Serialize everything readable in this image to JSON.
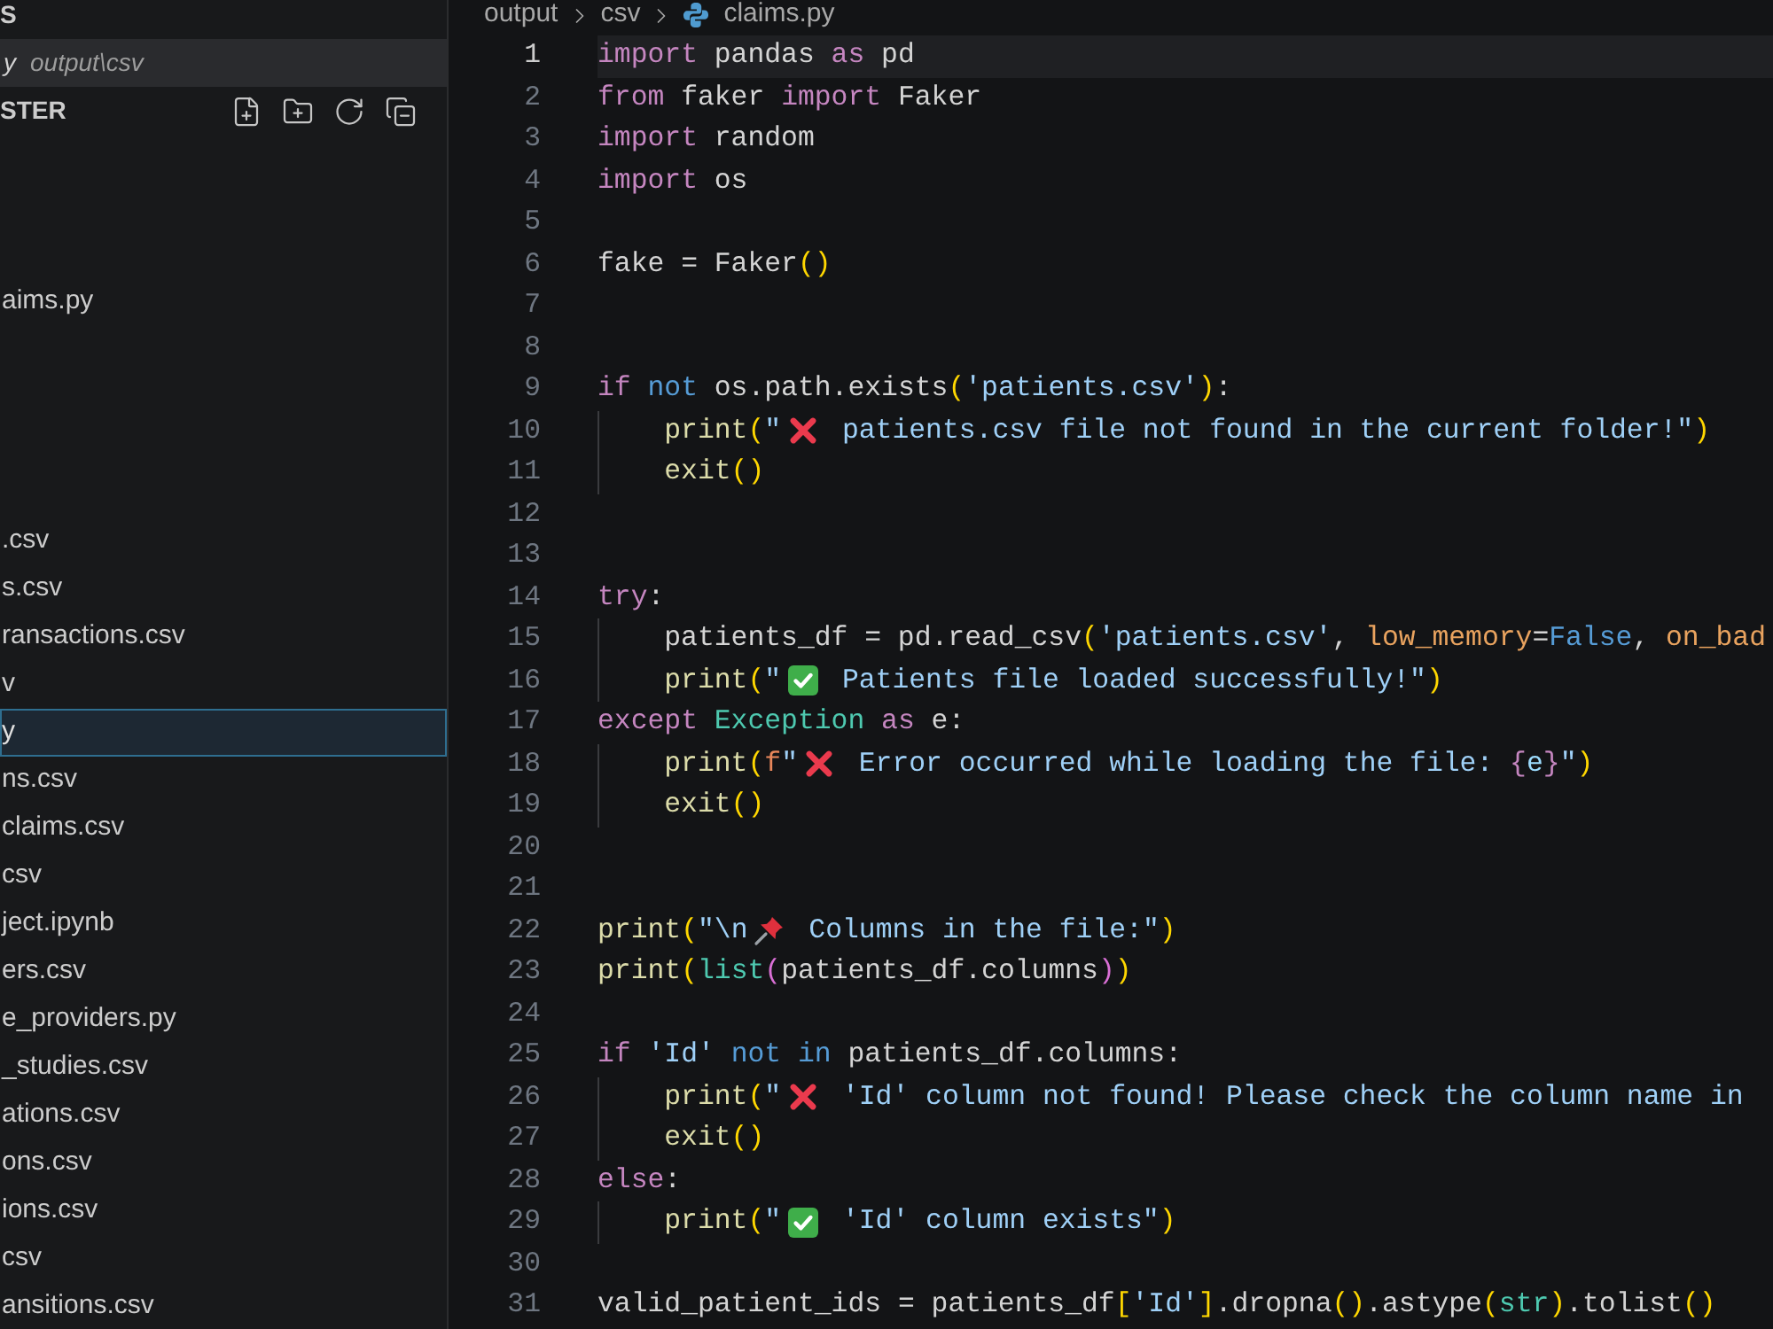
{
  "sidebar": {
    "section_title": "S",
    "open_editor": {
      "name": "y",
      "path": "output\\csv",
      "selected": true
    },
    "explorer": {
      "title": "STER",
      "top_items": [
        {
          "name": "aims.py",
          "selected": false
        }
      ],
      "items": [
        {
          "name": ".csv",
          "selected": false
        },
        {
          "name": "s.csv",
          "selected": false
        },
        {
          "name": "ransactions.csv",
          "selected": false
        },
        {
          "name": "v",
          "selected": false
        },
        {
          "name": "y",
          "selected": true
        },
        {
          "name": "ns.csv",
          "selected": false
        },
        {
          "name": "claims.csv",
          "selected": false
        },
        {
          "name": "csv",
          "selected": false
        },
        {
          "name": "ject.ipynb",
          "selected": false
        },
        {
          "name": "ers.csv",
          "selected": false
        },
        {
          "name": "e_providers.py",
          "selected": false
        },
        {
          "name": "_studies.csv",
          "selected": false
        },
        {
          "name": "ations.csv",
          "selected": false
        },
        {
          "name": "ons.csv",
          "selected": false
        },
        {
          "name": "ions.csv",
          "selected": false
        },
        {
          "name": "csv",
          "selected": false
        },
        {
          "name": "ansitions.csv",
          "selected": false
        }
      ]
    }
  },
  "editor": {
    "breadcrumb": [
      {
        "kind": "folder",
        "text": "output"
      },
      {
        "kind": "folder",
        "text": "csv"
      },
      {
        "kind": "python",
        "text": "claims.py"
      }
    ],
    "lines": [
      {
        "number": "1",
        "current": true,
        "tokens": [
          {
            "kind": "keyword",
            "text": "import"
          },
          {
            "kind": "plain",
            "text": " pandas "
          },
          {
            "kind": "keyword",
            "text": "as"
          },
          {
            "kind": "plain",
            "text": " pd"
          }
        ]
      },
      {
        "number": "2",
        "current": false,
        "tokens": [
          {
            "kind": "keyword",
            "text": "from"
          },
          {
            "kind": "plain",
            "text": " faker "
          },
          {
            "kind": "keyword",
            "text": "import"
          },
          {
            "kind": "plain",
            "text": " Faker"
          }
        ]
      },
      {
        "number": "3",
        "current": false,
        "tokens": [
          {
            "kind": "keyword",
            "text": "import"
          },
          {
            "kind": "plain",
            "text": " random"
          }
        ]
      },
      {
        "number": "4",
        "current": false,
        "tokens": [
          {
            "kind": "keyword",
            "text": "import"
          },
          {
            "kind": "plain",
            "text": " os"
          }
        ]
      },
      {
        "number": "5",
        "current": false
      },
      {
        "number": "6",
        "current": false,
        "tokens": [
          {
            "kind": "plain",
            "text": "fake = Faker"
          },
          {
            "kind": "paren1",
            "text": "()"
          }
        ]
      },
      {
        "number": "7",
        "current": false
      },
      {
        "number": "8",
        "current": false
      },
      {
        "number": "9",
        "current": false,
        "tokens": [
          {
            "kind": "keyword",
            "text": "if"
          },
          {
            "kind": "logic",
            "text": " not"
          },
          {
            "kind": "plain",
            "text": " os.path.exists"
          },
          {
            "kind": "paren1",
            "text": "("
          },
          {
            "kind": "string",
            "text": "'patients.csv'"
          },
          {
            "kind": "paren1",
            "text": ")"
          },
          {
            "kind": "plain",
            "text": ":"
          }
        ]
      },
      {
        "number": "10",
        "current": false,
        "tokens": [
          {
            "kind": "indent"
          },
          {
            "kind": "function",
            "text": "print"
          },
          {
            "kind": "paren1",
            "text": "("
          },
          {
            "kind": "string",
            "text": "\""
          },
          {
            "kind": "cross"
          },
          {
            "kind": "string",
            "text": " patients.csv file not found in the current folder!\""
          },
          {
            "kind": "paren1",
            "text": ")"
          }
        ]
      },
      {
        "number": "11",
        "current": false,
        "tokens": [
          {
            "kind": "indent"
          },
          {
            "kind": "function",
            "text": "exit"
          },
          {
            "kind": "paren1",
            "text": "()"
          }
        ]
      },
      {
        "number": "12",
        "current": false
      },
      {
        "number": "13",
        "current": false
      },
      {
        "number": "14",
        "current": false,
        "tokens": [
          {
            "kind": "keyword",
            "text": "try"
          },
          {
            "kind": "plain",
            "text": ":"
          }
        ]
      },
      {
        "number": "15",
        "current": false,
        "tokens": [
          {
            "kind": "indent"
          },
          {
            "kind": "plain",
            "text": "patients_df = pd.read_csv"
          },
          {
            "kind": "paren1",
            "text": "("
          },
          {
            "kind": "string",
            "text": "'patients.csv'"
          },
          {
            "kind": "plain",
            "text": ", "
          },
          {
            "kind": "param",
            "text": "low_memory"
          },
          {
            "kind": "plain",
            "text": "="
          },
          {
            "kind": "constant",
            "text": "False"
          },
          {
            "kind": "plain",
            "text": ", "
          },
          {
            "kind": "param",
            "text": "on_bad"
          }
        ]
      },
      {
        "number": "16",
        "current": false,
        "tokens": [
          {
            "kind": "indent"
          },
          {
            "kind": "function",
            "text": "print"
          },
          {
            "kind": "paren1",
            "text": "("
          },
          {
            "kind": "string",
            "text": "\""
          },
          {
            "kind": "check"
          },
          {
            "kind": "string",
            "text": " Patients file loaded successfully!\""
          },
          {
            "kind": "paren1",
            "text": ")"
          }
        ]
      },
      {
        "number": "17",
        "current": false,
        "tokens": [
          {
            "kind": "keyword",
            "text": "except"
          },
          {
            "kind": "class",
            "text": " Exception"
          },
          {
            "kind": "keyword",
            "text": " as"
          },
          {
            "kind": "plain",
            "text": " e:"
          }
        ]
      },
      {
        "number": "18",
        "current": false,
        "tokens": [
          {
            "kind": "indent"
          },
          {
            "kind": "function",
            "text": "print"
          },
          {
            "kind": "paren1",
            "text": "("
          },
          {
            "kind": "prefix",
            "text": "f"
          },
          {
            "kind": "string",
            "text": "\""
          },
          {
            "kind": "cross"
          },
          {
            "kind": "string",
            "text": " Error occurred while loading the file: "
          },
          {
            "kind": "brace",
            "text": "{"
          },
          {
            "kind": "variable",
            "text": "e"
          },
          {
            "kind": "brace",
            "text": "}"
          },
          {
            "kind": "string",
            "text": "\""
          },
          {
            "kind": "paren1",
            "text": ")"
          }
        ]
      },
      {
        "number": "19",
        "current": false,
        "tokens": [
          {
            "kind": "indent"
          },
          {
            "kind": "function",
            "text": "exit"
          },
          {
            "kind": "paren1",
            "text": "()"
          }
        ]
      },
      {
        "number": "20",
        "current": false
      },
      {
        "number": "21",
        "current": false
      },
      {
        "number": "22",
        "current": false,
        "tokens": [
          {
            "kind": "function",
            "text": "print"
          },
          {
            "kind": "paren1",
            "text": "("
          },
          {
            "kind": "string",
            "text": "\"\\n"
          },
          {
            "kind": "pin"
          },
          {
            "kind": "string",
            "text": " Columns in the file:\""
          },
          {
            "kind": "paren1",
            "text": ")"
          }
        ]
      },
      {
        "number": "23",
        "current": false,
        "tokens": [
          {
            "kind": "function",
            "text": "print"
          },
          {
            "kind": "paren1",
            "text": "("
          },
          {
            "kind": "class",
            "text": "list"
          },
          {
            "kind": "paren2",
            "text": "("
          },
          {
            "kind": "plain",
            "text": "patients_df.columns"
          },
          {
            "kind": "paren2",
            "text": ")"
          },
          {
            "kind": "paren1",
            "text": ")"
          }
        ]
      },
      {
        "number": "24",
        "current": false
      },
      {
        "number": "25",
        "current": false,
        "tokens": [
          {
            "kind": "keyword",
            "text": "if"
          },
          {
            "kind": "string",
            "text": " 'Id'"
          },
          {
            "kind": "logic",
            "text": " not in"
          },
          {
            "kind": "plain",
            "text": " patients_df.columns:"
          }
        ]
      },
      {
        "number": "26",
        "current": false,
        "tokens": [
          {
            "kind": "indent"
          },
          {
            "kind": "function",
            "text": "print"
          },
          {
            "kind": "paren1",
            "text": "("
          },
          {
            "kind": "string",
            "text": "\""
          },
          {
            "kind": "cross"
          },
          {
            "kind": "string",
            "text": " 'Id' column not found! Please check the column name in"
          }
        ]
      },
      {
        "number": "27",
        "current": false,
        "tokens": [
          {
            "kind": "indent"
          },
          {
            "kind": "function",
            "text": "exit"
          },
          {
            "kind": "paren1",
            "text": "()"
          }
        ]
      },
      {
        "number": "28",
        "current": false,
        "tokens": [
          {
            "kind": "keyword",
            "text": "else"
          },
          {
            "kind": "plain",
            "text": ":"
          }
        ]
      },
      {
        "number": "29",
        "current": false,
        "tokens": [
          {
            "kind": "indent"
          },
          {
            "kind": "function",
            "text": "print"
          },
          {
            "kind": "paren1",
            "text": "("
          },
          {
            "kind": "string",
            "text": "\""
          },
          {
            "kind": "check"
          },
          {
            "kind": "string",
            "text": " 'Id' column exists\""
          },
          {
            "kind": "paren1",
            "text": ")"
          }
        ]
      },
      {
        "number": "30",
        "current": false
      },
      {
        "number": "31",
        "current": false,
        "tokens": [
          {
            "kind": "plain",
            "text": "valid_patient_ids = patients_df"
          },
          {
            "kind": "paren1",
            "text": "["
          },
          {
            "kind": "string",
            "text": "'Id'"
          },
          {
            "kind": "paren1",
            "text": "]"
          },
          {
            "kind": "plain",
            "text": ".dropna"
          },
          {
            "kind": "paren1",
            "text": "()"
          },
          {
            "kind": "plain",
            "text": ".astype"
          },
          {
            "kind": "paren1",
            "text": "("
          },
          {
            "kind": "class",
            "text": "str"
          },
          {
            "kind": "paren1",
            "text": ")"
          },
          {
            "kind": "plain",
            "text": ".tolist"
          },
          {
            "kind": "paren1",
            "text": "()"
          }
        ]
      }
    ]
  }
}
